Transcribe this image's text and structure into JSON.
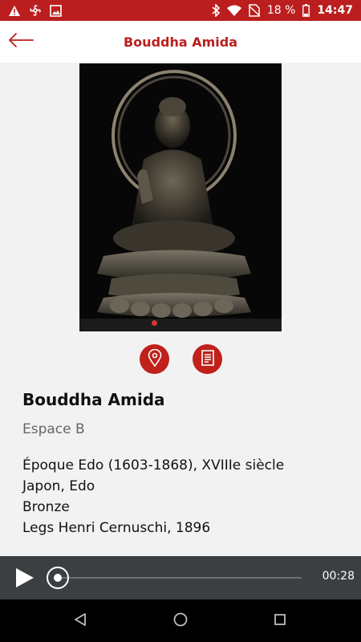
{
  "status_bar": {
    "battery_text": "18 %",
    "time": "14:47",
    "icons": [
      "warning-icon",
      "fan-icon",
      "image-icon",
      "bluetooth-icon",
      "wifi-icon",
      "no-sim-icon",
      "battery-icon"
    ]
  },
  "app_bar": {
    "title": "Bouddha Amida",
    "back_icon": "arrow-left-icon"
  },
  "artwork": {
    "image_subject": "Bronze Buddha Amida statue seated on a lotus pedestal with halo"
  },
  "actions": [
    {
      "name": "location-button",
      "icon": "map-pin-icon"
    },
    {
      "name": "notice-button",
      "icon": "document-icon"
    }
  ],
  "artwork_info": {
    "title": "Bouddha Amida",
    "location": "Espace B",
    "details": [
      "Époque Edo (1603-1868), XVIIIe siècle",
      "Japon, Edo",
      "Bronze",
      "Legs Henri Cernuschi, 1896"
    ]
  },
  "player": {
    "time": "00:28",
    "progress": 0
  },
  "colors": {
    "accent": "#bb1e1e",
    "player_bg": "#3c3f41",
    "background": "#f2f2f2"
  }
}
